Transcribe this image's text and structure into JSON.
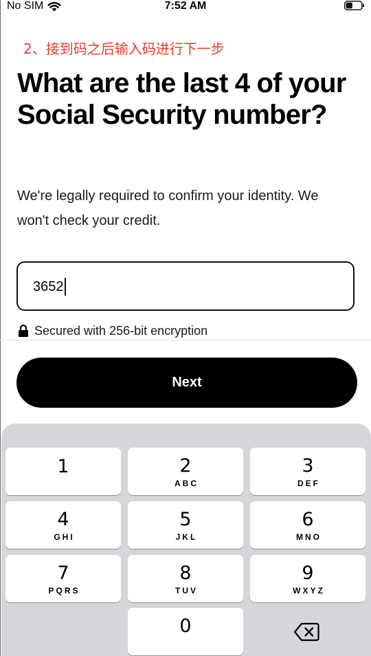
{
  "status_bar": {
    "carrier": "No SIM",
    "time": "7:52 AM"
  },
  "annotation": "2、接到码之后输入码进行下一步",
  "heading": "What are the last 4 of your Social Security number?",
  "subtitle": "We're legally required to confirm your identity. We won't check your credit.",
  "ssn_input": {
    "value": "3652"
  },
  "secure_note": "Secured with 256-bit encryption",
  "next_button": {
    "label": "Next"
  },
  "keypad": {
    "keys": [
      {
        "digit": "1",
        "letters": ""
      },
      {
        "digit": "2",
        "letters": "ABC"
      },
      {
        "digit": "3",
        "letters": "DEF"
      },
      {
        "digit": "4",
        "letters": "GHI"
      },
      {
        "digit": "5",
        "letters": "JKL"
      },
      {
        "digit": "6",
        "letters": "MNO"
      },
      {
        "digit": "7",
        "letters": "PQRS"
      },
      {
        "digit": "8",
        "letters": "TUV"
      },
      {
        "digit": "9",
        "letters": "WXYZ"
      },
      {
        "digit": "0",
        "letters": ""
      }
    ]
  },
  "icons": {
    "wifi": "wifi-icon",
    "battery": "battery-icon",
    "lock": "lock-icon",
    "delete": "delete-backspace-icon"
  },
  "colors": {
    "annotation": "#ef3b2c",
    "button_bg": "#000000",
    "keypad_bg": "#d4d6da"
  }
}
